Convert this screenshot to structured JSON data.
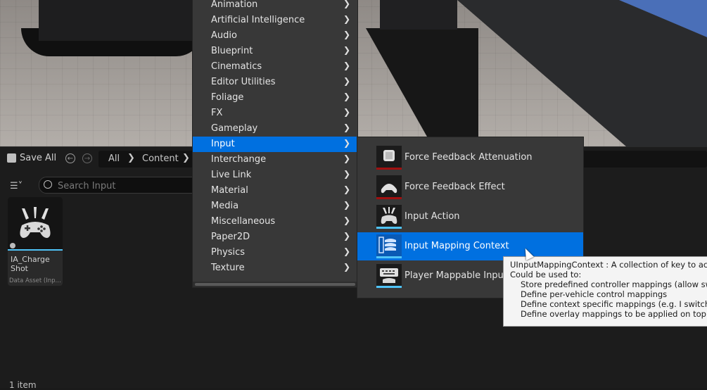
{
  "toolbar": {
    "save_all": "Save All",
    "breadcrumbs": [
      "All",
      "Content"
    ]
  },
  "search": {
    "placeholder": "Search Input"
  },
  "asset": {
    "name": "IA_Charge Shot",
    "type": "Data Asset (Inp..."
  },
  "status": {
    "item_count": "1 item"
  },
  "menu": {
    "items": [
      {
        "label": "Animation"
      },
      {
        "label": "Artificial Intelligence"
      },
      {
        "label": "Audio"
      },
      {
        "label": "Blueprint"
      },
      {
        "label": "Cinematics"
      },
      {
        "label": "Editor Utilities"
      },
      {
        "label": "Foliage"
      },
      {
        "label": "FX"
      },
      {
        "label": "Gameplay"
      },
      {
        "label": "Input"
      },
      {
        "label": "Interchange"
      },
      {
        "label": "Live Link"
      },
      {
        "label": "Material"
      },
      {
        "label": "Media"
      },
      {
        "label": "Miscellaneous"
      },
      {
        "label": "Paper2D"
      },
      {
        "label": "Physics"
      },
      {
        "label": "Texture"
      }
    ],
    "selected": "Input"
  },
  "submenu": {
    "items": [
      {
        "label": "Force Feedback Attenuation",
        "icon": "force-feedback-attenuation-icon",
        "bar_color": "#a01010"
      },
      {
        "label": "Force Feedback Effect",
        "icon": "force-feedback-effect-icon",
        "bar_color": "#a01010"
      },
      {
        "label": "Input Action",
        "icon": "input-action-icon",
        "bar_color": "#4fc3f7"
      },
      {
        "label": "Input Mapping Context",
        "icon": "input-mapping-context-icon",
        "bar_color": "#4fc3f7"
      },
      {
        "label": "Player Mappable Input C",
        "icon": "player-mappable-input-icon",
        "bar_color": "#4fc3f7"
      }
    ],
    "selected": "Input Mapping Context"
  },
  "tooltip": {
    "line1": "UInputMappingContext : A collection of key to actio",
    "line2": "Could be used to:",
    "line3": "Store predefined controller mappings (allow switc",
    "line4": "Define per-vehicle control mappings",
    "line5": "Define context specific mappings (e.g. I switch fro",
    "line6": "Define overlay mappings to be applied on top of e"
  },
  "colors": {
    "selection": "#0070e0",
    "menu_bg": "#383838",
    "accent_blue": "#4fc3f7",
    "accent_red": "#a01010"
  }
}
